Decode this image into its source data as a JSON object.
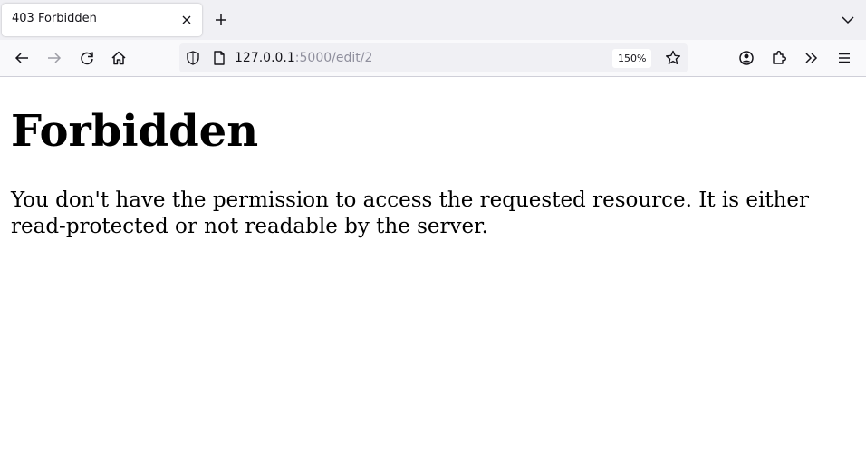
{
  "browser": {
    "tab": {
      "title": "403 Forbidden"
    },
    "url": {
      "host": "127.0.0.1",
      "path": ":5000/edit/2"
    },
    "zoom": "150%",
    "icons": {
      "tab_close": "close-icon",
      "new_tab": "plus-icon",
      "tab_list": "chevron-down-icon",
      "back": "arrow-left-icon",
      "forward": "arrow-right-icon",
      "reload": "reload-icon",
      "home": "home-icon",
      "tracking": "shield-icon",
      "page_info": "page-icon",
      "bookmark": "star-icon",
      "account": "account-icon",
      "extensions": "puzzle-icon",
      "overflow": "double-chevron-icon",
      "menu": "hamburger-icon"
    }
  },
  "page": {
    "heading": "Forbidden",
    "message": "You don't have the permission to access the requested resource. It is either read-protected or not readable by the server."
  }
}
